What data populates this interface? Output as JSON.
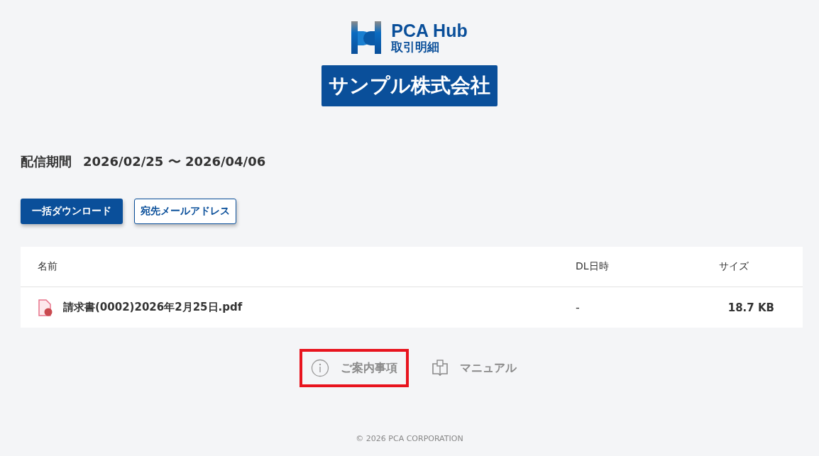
{
  "logo": {
    "brand": "PCA Hub",
    "product": "取引明細"
  },
  "company": "サンプル株式会社",
  "period": {
    "label": "配信期間",
    "value": "2026/02/25 〜 2026/04/06"
  },
  "buttons": [
    {
      "label": "一括ダウンロード",
      "kind": "primary"
    },
    {
      "label": "宛先メールアドレス",
      "kind": "outline"
    }
  ],
  "table": {
    "columns": [
      "名前",
      "DL日時",
      "サイズ"
    ],
    "rows": [
      {
        "name": "請求書(0002)2026年2月25日.pdf",
        "downloaded": "-",
        "size": "18.7 KB"
      }
    ]
  },
  "links": [
    {
      "label": "ご案内事項",
      "kind": "info",
      "highlighted": true
    },
    {
      "label": "マニュアル",
      "kind": "manual",
      "highlighted": false
    }
  ],
  "footer": "© 2026 PCA CORPORATION"
}
